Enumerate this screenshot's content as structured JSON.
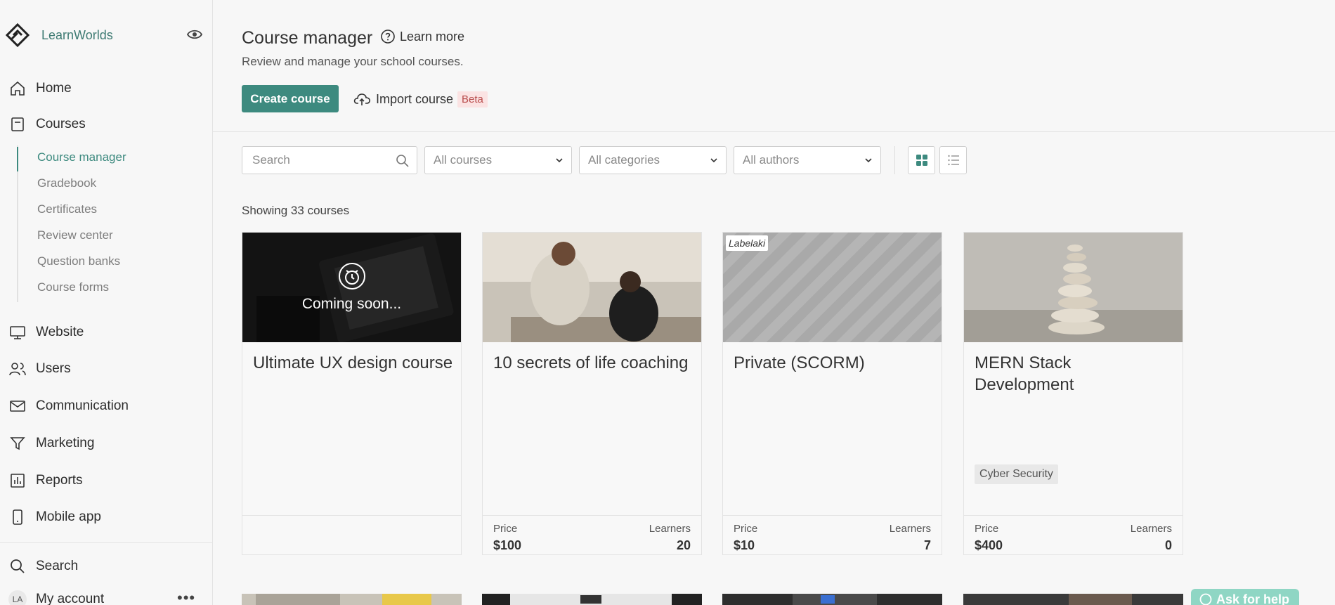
{
  "sidebar": {
    "brand": "LearnWorlds",
    "nav": [
      {
        "label": "Home",
        "icon": "home-icon"
      },
      {
        "label": "Courses",
        "icon": "book-icon"
      },
      {
        "label": "Website",
        "icon": "monitor-icon"
      },
      {
        "label": "Users",
        "icon": "users-icon"
      },
      {
        "label": "Communication",
        "icon": "mail-icon"
      },
      {
        "label": "Marketing",
        "icon": "filter-icon"
      },
      {
        "label": "Reports",
        "icon": "bar-chart-icon"
      },
      {
        "label": "Mobile app",
        "icon": "mobile-icon"
      }
    ],
    "sub_nav": [
      "Course manager",
      "Gradebook",
      "Certificates",
      "Review center",
      "Question banks",
      "Course forms"
    ],
    "search_label": "Search",
    "account": {
      "initials": "LA",
      "label": "My account"
    }
  },
  "header": {
    "title": "Course manager",
    "learn_more": "Learn more",
    "subtitle": "Review and manage your school courses.",
    "create_button": "Create course",
    "import_button": "Import course",
    "beta_badge": "Beta"
  },
  "filters": {
    "search_placeholder": "Search",
    "courses_select": "All courses",
    "categories_select": "All categories",
    "authors_select": "All authors"
  },
  "showing_text": "Showing 33 courses",
  "cards": [
    {
      "title": "Ultimate UX design course",
      "overlay": "Coming soon...",
      "price_label": "",
      "price": "",
      "learners_label": "",
      "learners": ""
    },
    {
      "title": "10 secrets of life coaching",
      "price_label": "Price",
      "price": "$100",
      "learners_label": "Learners",
      "learners": "20"
    },
    {
      "title": "Private (SCORM)",
      "badge": "Labelaki",
      "price_label": "Price",
      "price": "$10",
      "learners_label": "Learners",
      "learners": "7"
    },
    {
      "title": "MERN Stack Development",
      "tag": "Cyber Security",
      "price_label": "Price",
      "price": "$400",
      "learners_label": "Learners",
      "learners": "0"
    }
  ],
  "help_button": "Ask for help",
  "colors": {
    "accent": "#3d8a7f",
    "beta_bg": "#fbe3e3",
    "help_bg": "#8fd6c4"
  }
}
